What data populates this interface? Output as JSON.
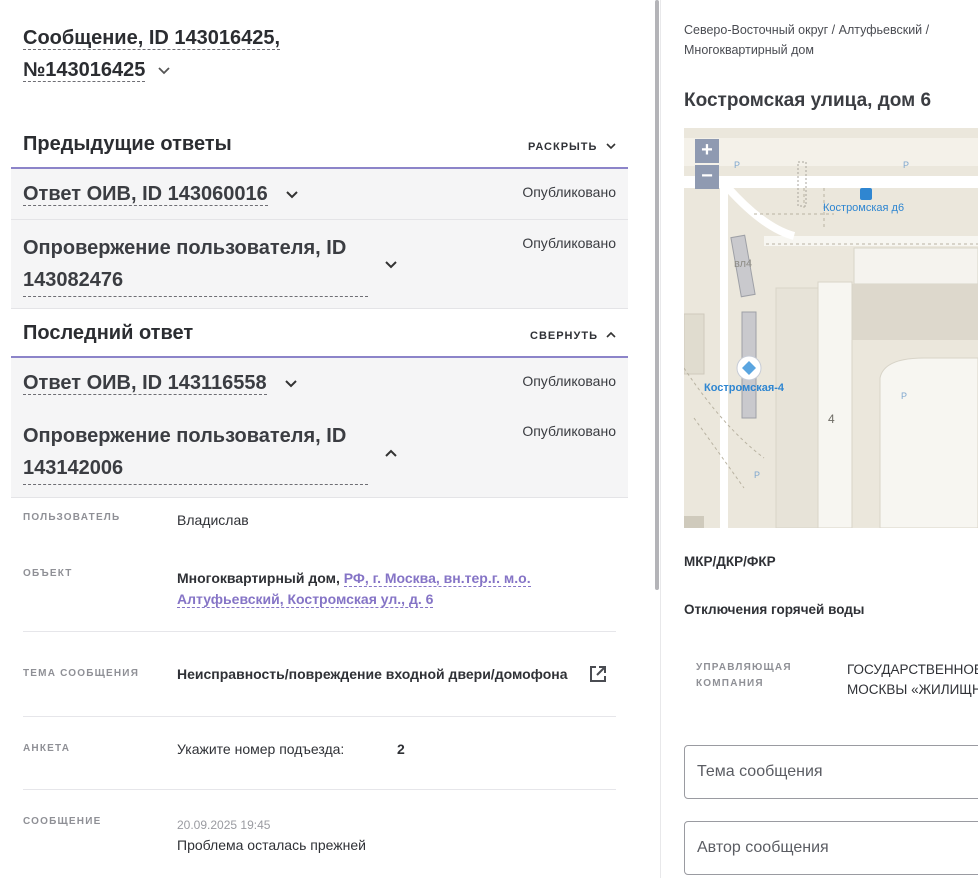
{
  "header": {
    "line1": "Сообщение, ID 143016425,",
    "line2": "№143016425"
  },
  "previous": {
    "title": "Предыдущие ответы",
    "toggle_label": "РАСКРЫТЬ",
    "answers": [
      {
        "title": "Ответ ОИВ, ID 143060016",
        "status": "Опубликовано"
      },
      {
        "title_line1": "Опровержение пользователя, ID",
        "title_line2": "143082476",
        "status": "Опубликовано"
      }
    ]
  },
  "last": {
    "title": "Последний ответ",
    "toggle_label": "СВЕРНУТЬ",
    "answers": [
      {
        "title": "Ответ ОИВ, ID 143116558",
        "status": "Опубликовано"
      },
      {
        "title_line1": "Опровержение пользователя, ID",
        "title_line2": "143142006",
        "status": "Опубликовано"
      }
    ]
  },
  "details": {
    "user_label": "ПОЛЬЗОВАТЕЛЬ",
    "user_value": "Владислав",
    "object_label": "ОБЪЕКТ",
    "object_type": "Многоквартирный дом,",
    "object_link_line1": "РФ, г. Москва, вн.тер.г. м.о.",
    "object_link_line2": "Алтуфьевский, Костромская ул., д. 6",
    "topic_label": "ТЕМА СООБЩЕНИЯ",
    "topic_value": "Неисправность/повреждение входной двери/домофона",
    "form_label": "АНКЕТА",
    "form_question": "Укажите номер подъезда:",
    "form_answer": "2",
    "message_label": "СООБЩЕНИЕ",
    "message_date": "20.09.2025 19:45",
    "message_text": "Проблема осталась прежней"
  },
  "right": {
    "breadcrumb_line1": "Северо-Восточный округ / Алтуфьевский /",
    "breadcrumb_line2": "Многоквартирный дом",
    "address": "Костромская улица, дом 6",
    "map": {
      "zoom_in": "+",
      "zoom_out": "−",
      "bus_stop": "Костромская д6",
      "label_vl4": "вл4",
      "label_kostr4": "Костромская-4",
      "label_4": "4",
      "parking": "P"
    },
    "program": "МКР/ДКР/ФКР",
    "shutdown": "Отключения горячей воды",
    "mgmt_label_line1": "УПРАВЛЯЮЩАЯ",
    "mgmt_label_line2": "КОМПАНИЯ",
    "mgmt_value_line1": "ГОСУДАРСТВЕННОЕ",
    "mgmt_value_line2": "МОСКВЫ «ЖИЛИЩН",
    "topic_placeholder": "Тема сообщения",
    "author_placeholder": "Автор сообщения"
  },
  "colors": {
    "accent": "#8c84c9",
    "link": "#8574c6",
    "block_bg": "#f5f5f6",
    "map_bg": "#ebe7dc"
  }
}
